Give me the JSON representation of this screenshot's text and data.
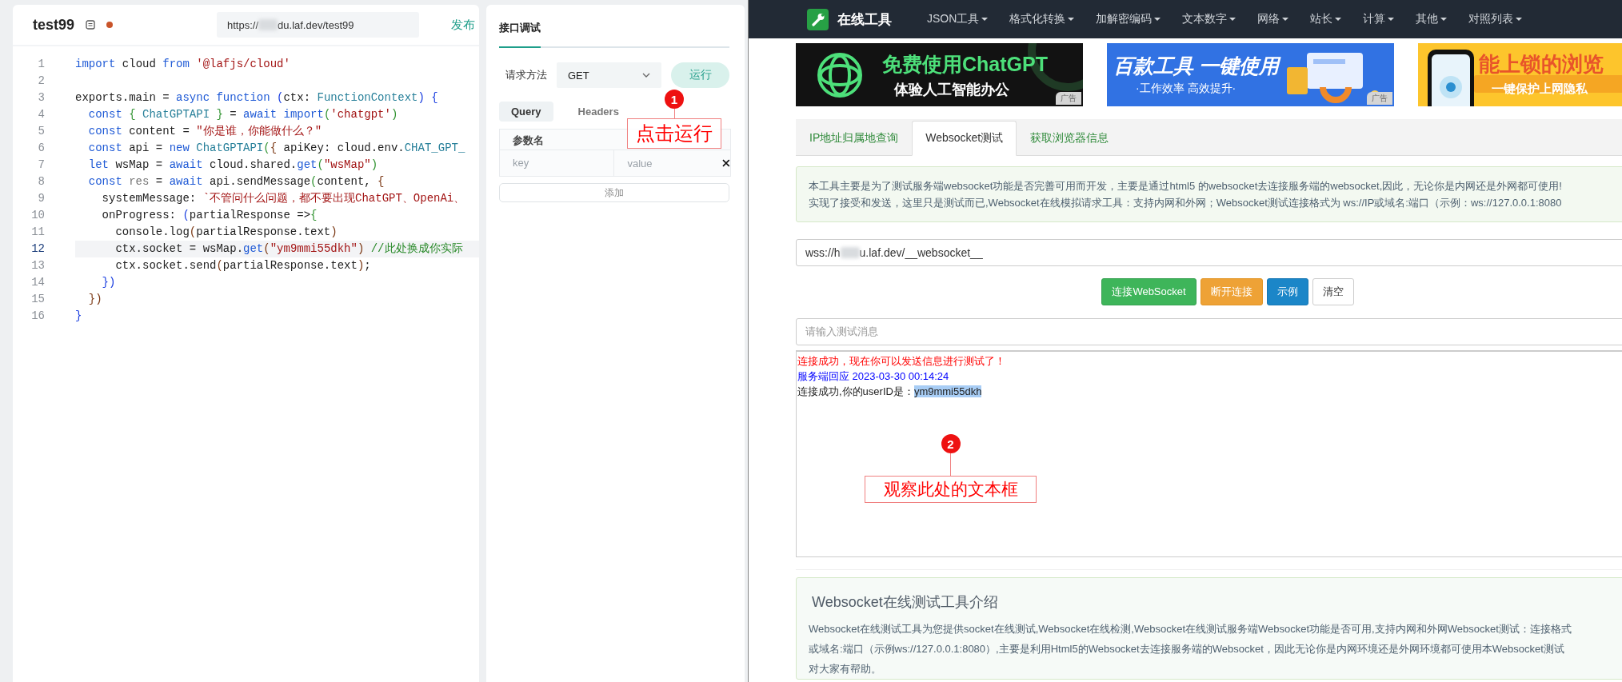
{
  "editor": {
    "title": "test99",
    "unsaved": true,
    "url_start": "https://",
    "url_end": "du.laf.dev/test99",
    "publish": "发布",
    "lines": [
      {
        "number": "1",
        "current": false,
        "tokens": [
          {
            "kind": "kw",
            "text": "import"
          },
          {
            "kind": "plain",
            "text": " cloud "
          },
          {
            "kind": "kw",
            "text": "from"
          },
          {
            "kind": "str",
            "text": " '@lafjs/cloud'"
          }
        ]
      },
      {
        "number": "2",
        "current": false
      },
      {
        "number": "3",
        "current": false,
        "tokens": [
          {
            "kind": "plain",
            "text": "exports.main = "
          },
          {
            "kind": "kw",
            "text": "async function"
          },
          {
            "kind": "b1",
            "text": " ("
          },
          {
            "kind": "plain",
            "text": "ctx: "
          },
          {
            "kind": "type",
            "text": "FunctionContext"
          },
          {
            "kind": "b1",
            "text": ") {"
          }
        ]
      },
      {
        "number": "4",
        "current": false,
        "tokens": [
          {
            "kind": "kw",
            "text": "  const"
          },
          {
            "kind": "b2",
            "text": " {"
          },
          {
            "kind": "type",
            "text": " ChatGPTAPI"
          },
          {
            "kind": "b2",
            "text": " }"
          },
          {
            "kind": "plain",
            "text": " = "
          },
          {
            "kind": "kw",
            "text": "await import"
          },
          {
            "kind": "b2",
            "text": "("
          },
          {
            "kind": "str",
            "text": "'chatgpt'"
          },
          {
            "kind": "b2",
            "text": ")"
          }
        ]
      },
      {
        "number": "5",
        "current": false,
        "tokens": [
          {
            "kind": "kw",
            "text": "  const"
          },
          {
            "kind": "plain",
            "text": " content = "
          },
          {
            "kind": "str",
            "text": "\"你是谁，你能做什么？\""
          }
        ]
      },
      {
        "number": "6",
        "current": false,
        "tokens": [
          {
            "kind": "kw",
            "text": "  const"
          },
          {
            "kind": "plain",
            "text": " api = "
          },
          {
            "kind": "kw",
            "text": "new"
          },
          {
            "kind": "type",
            "text": " ChatGPTAPI"
          },
          {
            "kind": "b2",
            "text": "("
          },
          {
            "kind": "b3",
            "text": "{"
          },
          {
            "kind": "plain",
            "text": " apiKey: cloud.env."
          },
          {
            "kind": "type",
            "text": "CHAT_GPT_"
          }
        ]
      },
      {
        "number": "7",
        "current": false,
        "tokens": [
          {
            "kind": "kw",
            "text": "  let"
          },
          {
            "kind": "plain",
            "text": " wsMap = "
          },
          {
            "kind": "kw",
            "text": "await"
          },
          {
            "kind": "plain",
            "text": " cloud.shared."
          },
          {
            "kind": "kw",
            "text": "get"
          },
          {
            "kind": "b2",
            "text": "("
          },
          {
            "kind": "str",
            "text": "\"wsMap\""
          },
          {
            "kind": "b2",
            "text": ")"
          }
        ]
      },
      {
        "number": "8",
        "current": false,
        "tokens": [
          {
            "kind": "kw",
            "text": "  const"
          },
          {
            "kind": "dim",
            "text": " res"
          },
          {
            "kind": "plain",
            "text": " = "
          },
          {
            "kind": "kw",
            "text": "await"
          },
          {
            "kind": "plain",
            "text": " api.sendMessage"
          },
          {
            "kind": "b2",
            "text": "("
          },
          {
            "kind": "plain",
            "text": "content, "
          },
          {
            "kind": "b3",
            "text": "{"
          }
        ]
      },
      {
        "number": "9",
        "current": false,
        "tokens": [
          {
            "kind": "plain",
            "text": "    systemMessage: "
          },
          {
            "kind": "str",
            "text": "`不管问什么问题，都不要出现ChatGPT、OpenAi、"
          }
        ]
      },
      {
        "number": "10",
        "current": false,
        "tokens": [
          {
            "kind": "plain",
            "text": "    onProgress: "
          },
          {
            "kind": "b1",
            "text": "("
          },
          {
            "kind": "plain",
            "text": "partialResponse =>"
          },
          {
            "kind": "b2",
            "text": "{"
          }
        ]
      },
      {
        "number": "11",
        "current": false,
        "tokens": [
          {
            "kind": "plain",
            "text": "      console.log"
          },
          {
            "kind": "b3",
            "text": "("
          },
          {
            "kind": "plain",
            "text": "partialResponse.text"
          },
          {
            "kind": "b3",
            "text": ")"
          }
        ]
      },
      {
        "number": "12",
        "current": true,
        "tokens": [
          {
            "kind": "plain",
            "text": "      ctx.socket = wsMap."
          },
          {
            "kind": "kw",
            "text": "get"
          },
          {
            "kind": "b3",
            "text": "("
          },
          {
            "kind": "str",
            "text": "\"ym9mmi55dkh\""
          },
          {
            "kind": "b3",
            "text": ")"
          },
          {
            "kind": "comment",
            "text": " //此处换成你实际"
          }
        ]
      },
      {
        "number": "13",
        "current": false,
        "tokens": [
          {
            "kind": "plain",
            "text": "      ctx.socket.send"
          },
          {
            "kind": "b3",
            "text": "("
          },
          {
            "kind": "plain",
            "text": "partialResponse.text"
          },
          {
            "kind": "b3",
            "text": ")"
          },
          {
            "kind": "plain",
            "text": ";"
          }
        ]
      },
      {
        "number": "14",
        "current": false,
        "tokens": [
          {
            "kind": "b1",
            "text": "    })"
          }
        ]
      },
      {
        "number": "15",
        "current": false,
        "tokens": [
          {
            "kind": "b3",
            "text": "  })"
          }
        ]
      },
      {
        "number": "16",
        "current": false,
        "tokens": [
          {
            "kind": "b1",
            "text": "}"
          }
        ]
      }
    ]
  },
  "debug": {
    "title": "接口调试",
    "method_label": "请求方法",
    "method": "GET",
    "run": "运行",
    "tabs": [
      {
        "label": "Query",
        "selected": true
      },
      {
        "label": "Headers",
        "selected": false
      }
    ],
    "column_1": "参数名",
    "key_placeholder": "key",
    "value_placeholder": "value",
    "add": "添加"
  },
  "browser": {
    "brand": "在线工具",
    "menu": [
      "JSON工具",
      "格式化转换",
      "加解密编码",
      "文本数字",
      "网络",
      "站长",
      "计算",
      "其他",
      "对照列表"
    ],
    "ads": [
      {
        "kind": "dark",
        "title": "免费使用ChatGPT",
        "subtitle": "体验人工智能办公",
        "badge": "广告"
      },
      {
        "kind": "blue",
        "title": "百款工具 一键使用",
        "subtitle": "·工作效率 高效提升·",
        "badge": "广告"
      },
      {
        "kind": "yellow",
        "title": "能上锁的浏览",
        "subtitle": "一键保护上网隐私"
      }
    ],
    "tabs": [
      {
        "label": "IP地址归属地查询",
        "selected": false
      },
      {
        "label": "Websocket测试",
        "selected": true
      },
      {
        "label": "获取浏览器信息",
        "selected": false
      }
    ],
    "notice": [
      "本工具主要是为了测试服务端websocket功能是否完善可用而开发，主要是通过html5 的websocket去连接服务端的websocket,因此，无论你是内网还是外网都可使用!",
      "实现了接受和发送，这里只是测试而已,Websocket在线模拟请求工具：支持内网和外网；Websocket测试连接格式为 ws://IP或域名:端口（示例：ws://127.0.0.1:8080"
    ],
    "url_start": "wss://h",
    "url_end": "u.laf.dev/__websocket__",
    "buttons": [
      {
        "kind": "success",
        "label": "连接WebSocket"
      },
      {
        "kind": "warning",
        "label": "断开连接"
      },
      {
        "kind": "primary",
        "label": "示例"
      },
      {
        "kind": "default",
        "label": "清空"
      }
    ],
    "message_placeholder": "请输入测试消息",
    "messages": [
      {
        "kind": "status",
        "text": "连接成功，现在你可以发送信息进行测试了！"
      },
      {
        "kind": "response",
        "text": "服务端回应 2023-03-30 00:14:24"
      },
      {
        "kind": "text",
        "text": "连接成功,你的userID是：",
        "selected_text": "ym9mmi55dkh"
      }
    ],
    "intro": {
      "title": "Websocket在线测试工具介绍",
      "lines": [
        "Websocket在线测试工具为您提供socket在线测试,Websocket在线检测,Websocket在线测试服务端Websocket功能是否可用,支持内网和外网Websocket测试：连接格式",
        "或域名:端口（示例ws://127.0.0.1:8080）,主要是利用Html5的Websocket去连接服务端的Websocket，因此无论你是内网环境还是外网环境都可使用本Websocket测试",
        "对大家有帮助。"
      ]
    }
  },
  "annotations": [
    {
      "number": "1",
      "label": "点击运行"
    },
    {
      "number": "2",
      "label": "观察此处的文本框"
    }
  ]
}
